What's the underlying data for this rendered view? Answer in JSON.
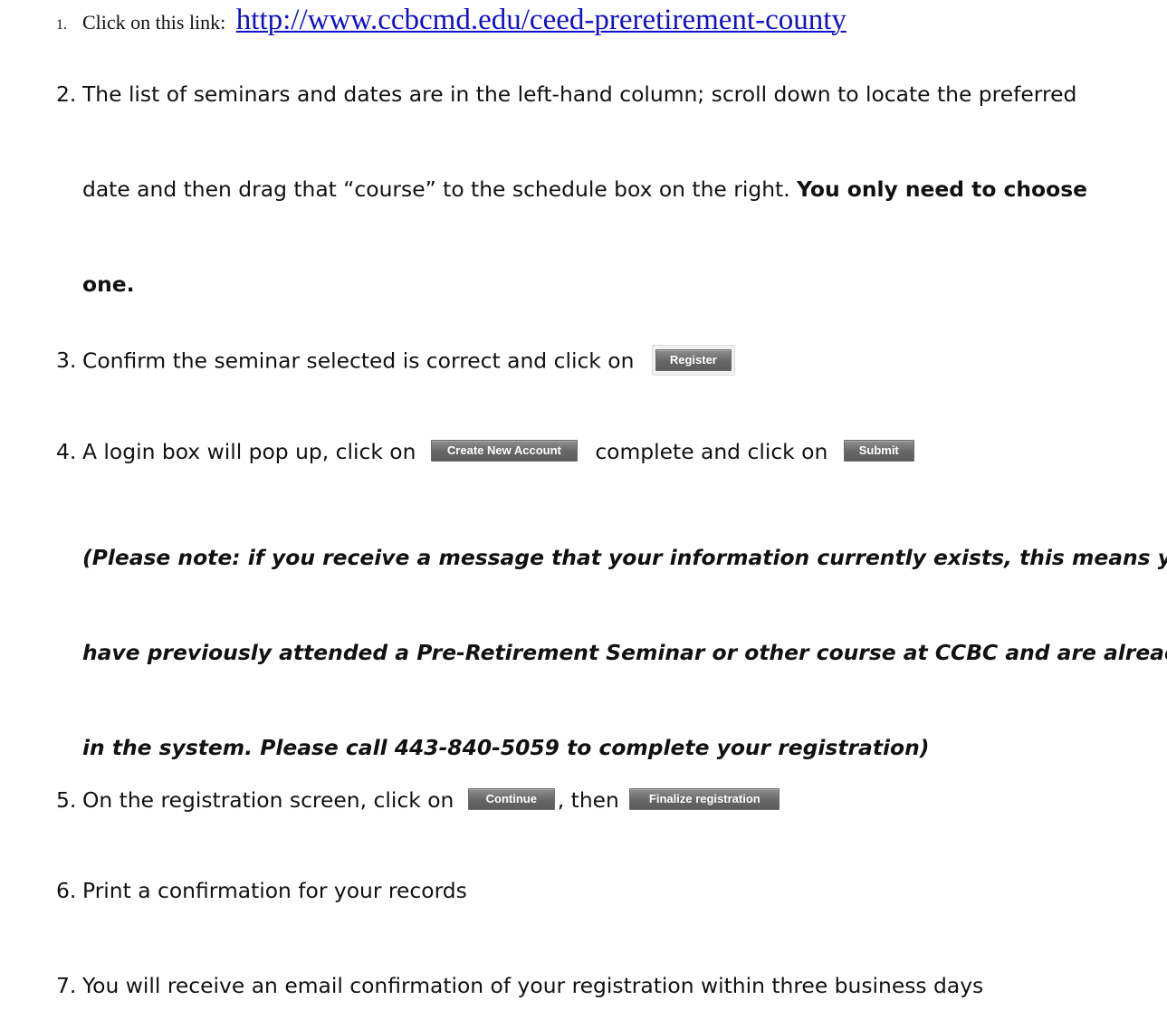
{
  "steps": [
    {
      "num": "1.",
      "text": "Click on this link: ",
      "link": "http://www.ccbcmd.edu/ceed-preretirement-county"
    },
    {
      "num": "2.",
      "line1": "The list of seminars and dates are in the left-hand column; scroll down to locate the preferred",
      "line2_text": "date and then drag that “course” to the schedule box on the right.  ",
      "line2_bold": "You only need to choose",
      "line3_bold": "one."
    },
    {
      "num": "3.",
      "text": "Confirm the seminar selected is correct and click on ",
      "button": "Register"
    },
    {
      "num": "4.",
      "text_a": "A login box will pop up, click on ",
      "button_a": "Create New Account",
      "text_b": " complete and click on ",
      "button_b": "Submit"
    },
    {
      "num": "5.",
      "text_a": "On the registration screen, click on ",
      "button_a": "Continue",
      "text_b": ", then ",
      "button_b": "Finalize registration"
    },
    {
      "num": "6.",
      "text": "Print a confirmation for your records"
    },
    {
      "num": "7.",
      "text": "You will receive an email confirmation of your registration within three business days"
    }
  ],
  "note": {
    "line1": "(Please note: if you receive a message that your information currently exists, this means you",
    "line2": "have previously attended a Pre-Retirement Seminar or other course at CCBC and are already",
    "line3": "in the system. Please call 443-840-5059 to complete your registration)"
  },
  "colors": {
    "link": "#1111c8",
    "button": "#676767",
    "text": "#111111"
  }
}
